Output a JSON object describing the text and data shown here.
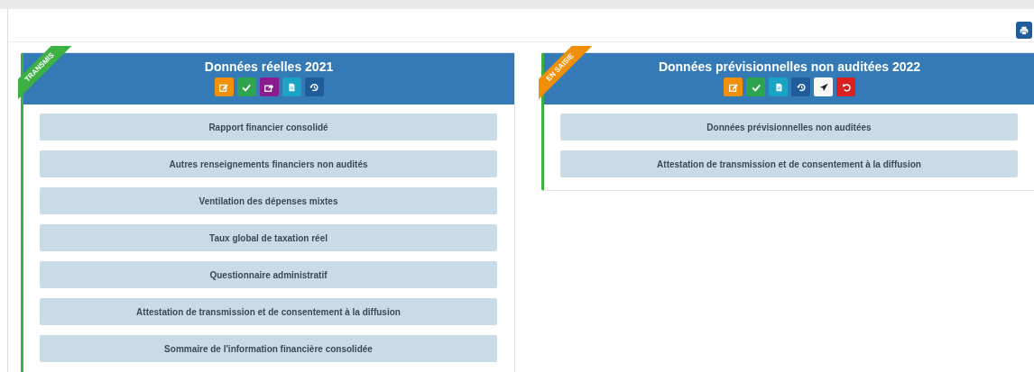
{
  "toolbar": {
    "print_button": {
      "kind": "print"
    }
  },
  "cards": [
    {
      "title": "Données réelles 2021",
      "ribbon": {
        "label": "TRANSMIS",
        "kind": "done"
      },
      "actions": [
        {
          "kind": "edit"
        },
        {
          "kind": "validate"
        },
        {
          "kind": "export"
        },
        {
          "kind": "document"
        },
        {
          "kind": "history"
        }
      ],
      "items": [
        "Rapport financier consolidé",
        "Autres renseignements financiers non audités",
        "Ventilation des dépenses mixtes",
        "Taux global de taxation réel",
        "Questionnaire administratif",
        "Attestation de transmission et de consentement à la diffusion",
        "Sommaire de l'information financière consolidée"
      ]
    },
    {
      "title": "Données prévisionnelles non auditées 2022",
      "ribbon": {
        "label": "EN SAISIE",
        "kind": "draft"
      },
      "actions": [
        {
          "kind": "edit"
        },
        {
          "kind": "validate"
        },
        {
          "kind": "document"
        },
        {
          "kind": "history"
        },
        {
          "kind": "send"
        },
        {
          "kind": "revert"
        }
      ],
      "items": [
        "Données prévisionnelles non auditées",
        "Attestation de transmission et de consentement à la diffusion"
      ]
    }
  ]
}
